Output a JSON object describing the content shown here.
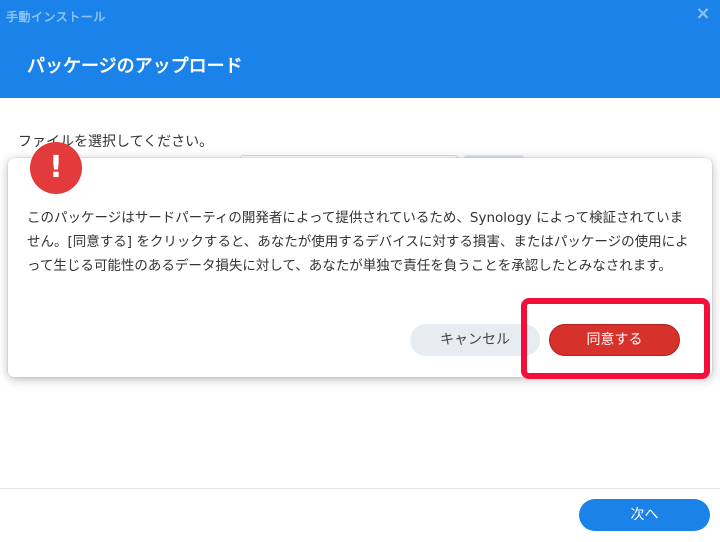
{
  "window": {
    "title": "手動インストール",
    "close_glyph": "×",
    "heading": "パッケージのアップロード"
  },
  "form": {
    "select_label": "ファイルを選択してください。"
  },
  "dialog": {
    "icon_glyph": "!",
    "message": "このパッケージはサードパーティの開発者によって提供されているため、Synology によって検証されていません。[同意する] をクリックすると、あなたが使用するデバイスに対する損害、またはパッケージの使用によって生じる可能性のあるデータ損失に対して、あなたが単独で責任を負うことを承認したとみなされます。",
    "cancel_label": "キャンセル",
    "agree_label": "同意する"
  },
  "footer": {
    "next_label": "次へ"
  },
  "colors": {
    "accent": "#1a82e8",
    "danger": "#d6312b",
    "highlight": "#f0103a"
  }
}
